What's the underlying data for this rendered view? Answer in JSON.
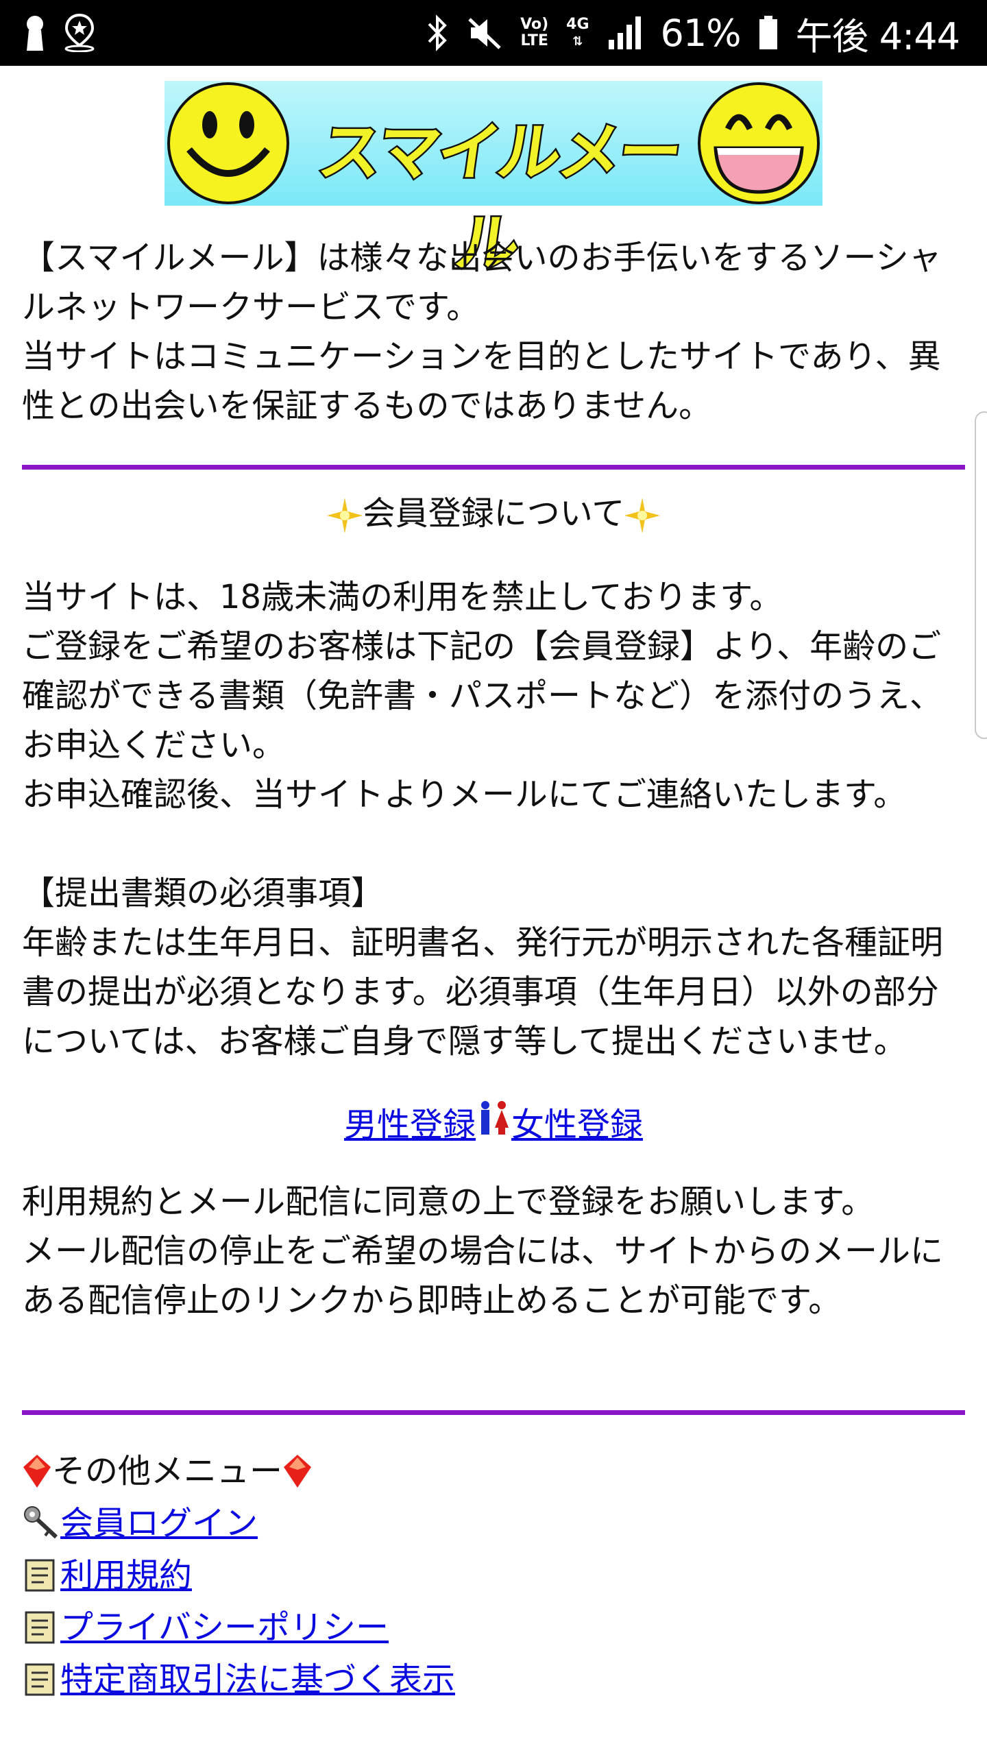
{
  "status_bar": {
    "battery": "61%",
    "time": "午後 4:44",
    "volte": "Vo)\nLTE",
    "network": "4G"
  },
  "banner": {
    "title": "スマイルメール"
  },
  "intro": {
    "line1": "【スマイルメール】は様々な出会いのお手伝いをするソーシャルネットワークサービスです。",
    "line2": "当サイトはコミュニケーションを目的としたサイトであり、異性との出会いを保証するものではありません。"
  },
  "registration": {
    "heading": "会員登録について",
    "p1": "当サイトは、18歳未満の利用を禁止しております。",
    "p2": "ご登録をご希望のお客様は下記の【会員登録】より、年齢のご確認ができる書類（免許書・パスポートなど）を添付のうえ、お申込ください。",
    "p3": "お申込確認後、当サイトよりメールにてご連絡いたします。",
    "required_heading": "【提出書類の必須事項】",
    "required_text": "年齢または生年月日、証明書名、発行元が明示された各種証明書の提出が必須となります。必須事項（生年月日）以外の部分については、お客様ご自身で隠す等して提出くださいませ。",
    "male_link": "男性登録",
    "female_link": "女性登録",
    "agree1": "利用規約とメール配信に同意の上で登録をお願いします。",
    "agree2": "メール配信の停止をご希望の場合には、サイトからのメールにある配信停止のリンクから即時止めることが可能です。"
  },
  "menu": {
    "heading": "その他メニュー",
    "items": [
      {
        "label": "会員ログイン",
        "icon": "key-icon"
      },
      {
        "label": "利用規約",
        "icon": "scroll-icon"
      },
      {
        "label": "プライバシーポリシー",
        "icon": "scroll-icon"
      },
      {
        "label": "特定商取引法に基づく表示",
        "icon": "scroll-icon"
      }
    ]
  },
  "colors": {
    "divider": "#8a16c8",
    "link": "#0a0ae0",
    "banner_bg": "#7ae8f7",
    "smiley": "#f5f21f"
  }
}
